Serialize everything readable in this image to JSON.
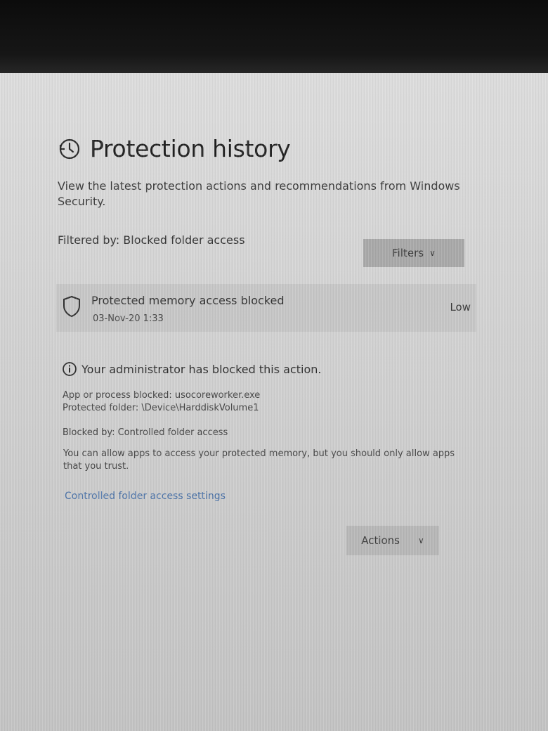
{
  "page": {
    "title": "Protection history",
    "subtitle": "View the latest protection actions and recommendations from Windows Security.",
    "filter_label": "Filtered by: Blocked folder access",
    "filters_button": "Filters",
    "title_icon": "history-clock-icon"
  },
  "event": {
    "title": "Protected memory access blocked",
    "date": "03-Nov-20 1:33",
    "severity": "Low",
    "icon": "shield-icon"
  },
  "details": {
    "admin_notice": "Your administrator has blocked this action.",
    "app_blocked": "App or process blocked: usocoreworker.exe",
    "protected_folder": "Protected folder: \\Device\\HarddiskVolume1",
    "blocked_by": "Blocked by: Controlled folder access",
    "allow_text": "You can allow apps to access your protected memory, but you should only allow apps that you trust.",
    "settings_link": "Controlled folder access settings",
    "actions_button": "Actions"
  },
  "colors": {
    "link": "#4a72a8",
    "button": "#a9a9a9",
    "background": "#d8d8d8"
  }
}
